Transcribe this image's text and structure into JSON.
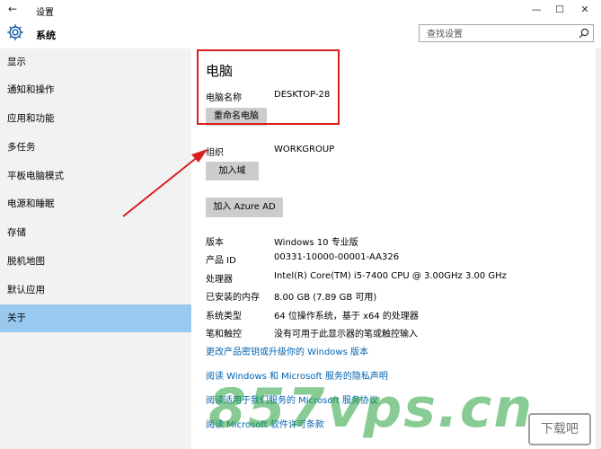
{
  "window": {
    "back_glyph": "←",
    "title": "设置",
    "minimize_glyph": "—",
    "maximize_glyph": "☐",
    "close_glyph": "✕"
  },
  "header": {
    "title": "系统",
    "search_placeholder": "查找设置"
  },
  "sidebar": {
    "items": [
      {
        "label": "显示"
      },
      {
        "label": "通知和操作"
      },
      {
        "label": "应用和功能"
      },
      {
        "label": "多任务"
      },
      {
        "label": "平板电脑模式"
      },
      {
        "label": "电源和睡眠"
      },
      {
        "label": "存储"
      },
      {
        "label": "脱机地图"
      },
      {
        "label": "默认应用"
      },
      {
        "label": "关于",
        "active": true
      }
    ]
  },
  "main": {
    "heading": "电脑",
    "pc_name_label": "电脑名称",
    "pc_name_value": "DESKTOP-28",
    "rename_button": "重命名电脑",
    "org_label": "组织",
    "org_value": "WORKGROUP",
    "join_domain_button": "加入域",
    "join_azure_button": "加入 Azure AD",
    "specs": [
      {
        "label": "版本",
        "value": "Windows 10 专业版"
      },
      {
        "label": "产品 ID",
        "value": "00331-10000-00001-AA326"
      },
      {
        "label": "处理器",
        "value": "Intel(R) Core(TM) i5-7400 CPU @ 3.00GHz   3.00 GHz"
      },
      {
        "label": "已安装的内存",
        "value": "8.00 GB (7.89 GB 可用)"
      },
      {
        "label": "系统类型",
        "value": "64 位操作系统，基于 x64 的处理器"
      },
      {
        "label": "笔和触控",
        "value": "没有可用于此显示器的笔或触控输入"
      }
    ],
    "links": [
      "更改产品密钥或升级你的 Windows 版本",
      "阅读 Windows 和 Microsoft 服务的隐私声明",
      "阅读适用于我们服务的 Microsoft 服务协议",
      "阅读 Microsoft 软件许可条款"
    ]
  },
  "overlay": {
    "highlight_color": "#d91e1e",
    "watermark_text": "857vps.cn",
    "watermark_logo": "下载吧"
  }
}
